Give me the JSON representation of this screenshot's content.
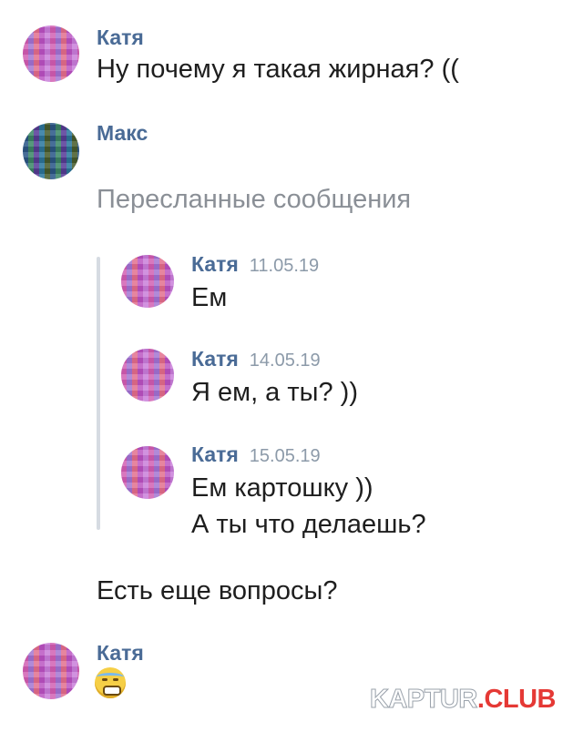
{
  "messages": [
    {
      "author": "Катя",
      "text": "Ну почему я такая жирная? (("
    },
    {
      "author": "Макс",
      "forwarded_label": "Пересланные сообщения"
    }
  ],
  "forwarded": [
    {
      "author": "Катя",
      "date": "11.05.19",
      "text": "Ем"
    },
    {
      "author": "Катя",
      "date": "14.05.19",
      "text": "Я ем, а ты? ))"
    },
    {
      "author": "Катя",
      "date": "15.05.19",
      "text_line1": "Ем картошку ))",
      "text_line2": "А ты что делаешь?"
    }
  ],
  "reply_text": "Есть еще вопросы?",
  "last": {
    "author": "Катя",
    "emoji": "sweating-smile-emoji"
  },
  "watermark": {
    "part1": "KAPTUR",
    "part2": ".CLUB"
  }
}
